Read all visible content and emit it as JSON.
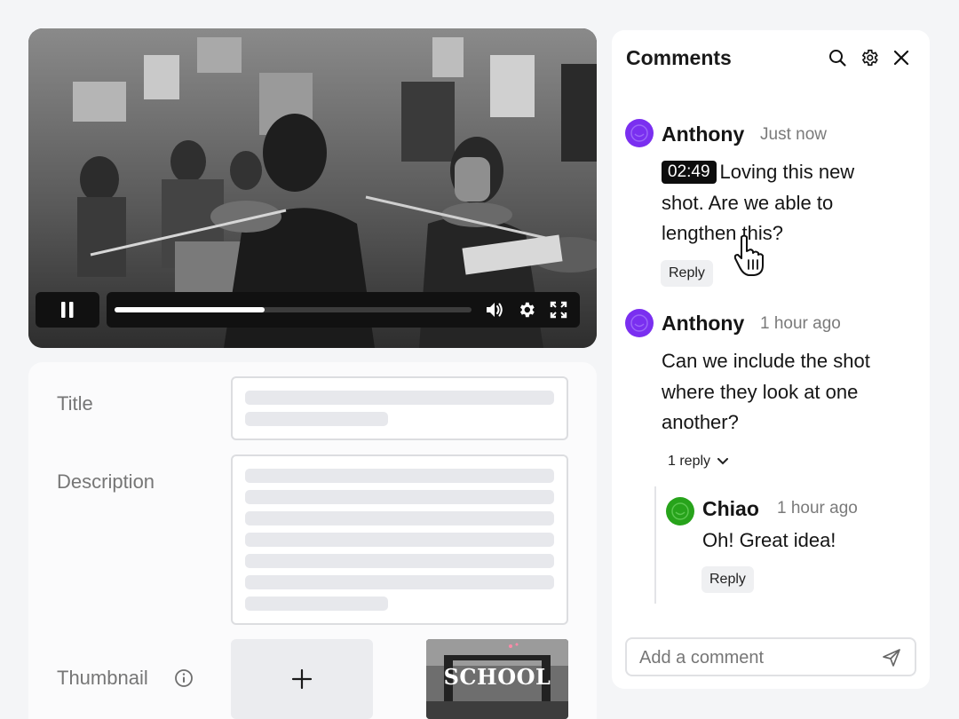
{
  "video": {
    "progress": 0.42,
    "play_state": "playing",
    "icons": [
      "pause-icon",
      "volume-icon",
      "settings-icon",
      "fullscreen-icon"
    ]
  },
  "form": {
    "title_label": "Title",
    "description_label": "Description",
    "thumbnail_label": "Thumbnail",
    "thumbnail_text": "SCHOOL"
  },
  "comments": {
    "header": "Comments",
    "items": [
      {
        "author": "Anthony",
        "time": "Just now",
        "timestamp": "02:49",
        "text": "Loving this new shot. Are we able to lengthen this?",
        "reply_label": "Reply",
        "avatar_color": "#7a2ff0"
      },
      {
        "author": "Anthony",
        "time": "1 hour ago",
        "text": "Can we include the shot where they look at one another?",
        "replies_label": "1 reply",
        "avatar_color": "#7a2ff0",
        "replies": [
          {
            "author": "Chiao",
            "time": "1 hour ago",
            "text": "Oh! Great idea!",
            "reply_label": "Reply",
            "avatar_color": "#27a31b"
          }
        ]
      }
    ],
    "input_placeholder": "Add a comment"
  },
  "colors": {
    "accent_purple": "#7a2ff0",
    "accent_green": "#27a31b",
    "background": "#f4f5f7"
  }
}
